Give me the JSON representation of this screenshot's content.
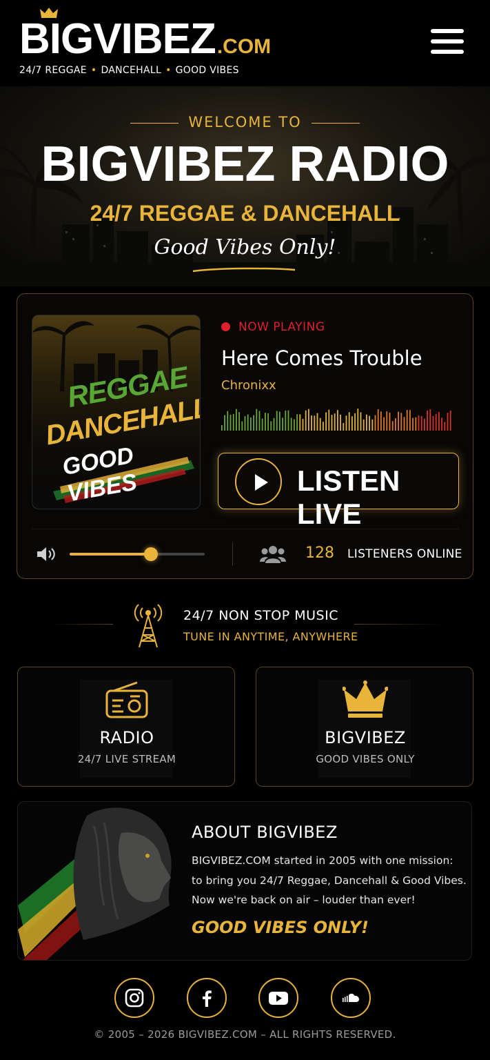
{
  "header": {
    "logo_main": "BIGVIBEZ",
    "logo_com": ".COM",
    "tagline_parts": [
      "24/7 REGGAE",
      "DANCEHALL",
      "GOOD VIBES"
    ],
    "menu_icon": "hamburger-menu-icon",
    "crown_icon": "crown-icon"
  },
  "hero": {
    "welcome": "WELCOME TO",
    "title": "BIGVIBEZ RADIO",
    "subtitle": "24/7 REGGAE & DANCEHALL",
    "script": "Good Vibes Only!"
  },
  "player": {
    "album_lines": [
      "REGGAE",
      "DANCEHALL",
      "GOOD VIBES"
    ],
    "now_playing_label": "NOW PLAYING",
    "track_title": "Here Comes Trouble",
    "artist": "Chronixx",
    "listen_label": "LISTEN LIVE",
    "volume_level": 0.6,
    "listener_count": "128",
    "listener_label": "LISTENERS ONLINE"
  },
  "nonstop": {
    "title": "24/7 NON STOP MUSIC",
    "subtitle": "TUNE IN ANYTIME, ANYWHERE",
    "icon": "radio-tower-icon"
  },
  "features": [
    {
      "title": "RADIO",
      "subtitle": "24/7 LIVE STREAM",
      "icon": "radio-icon"
    },
    {
      "title": "BIGVIBEZ",
      "subtitle": "GOOD VIBES ONLY",
      "icon": "crown-icon"
    }
  ],
  "about": {
    "title": "ABOUT BIGVIBEZ",
    "lines": [
      "BIGVIBEZ.COM started in 2005 with one mission:",
      "to bring you 24/7 Reggae, Dancehall & Good Vibes.",
      "Now we're back on air – louder than ever!"
    ],
    "slogan": "GOOD VIBES ONLY!"
  },
  "social": [
    "instagram-icon",
    "facebook-icon",
    "youtube-icon",
    "soundcloud-icon"
  ],
  "footer": "© 2005 – 2026 BIGVIBEZ.COM – ALL RIGHTS RESERVED.",
  "colors": {
    "accent": "#e8b43a",
    "live_red": "#e0202a",
    "background": "#000000",
    "reggae_green": "#58a636"
  }
}
